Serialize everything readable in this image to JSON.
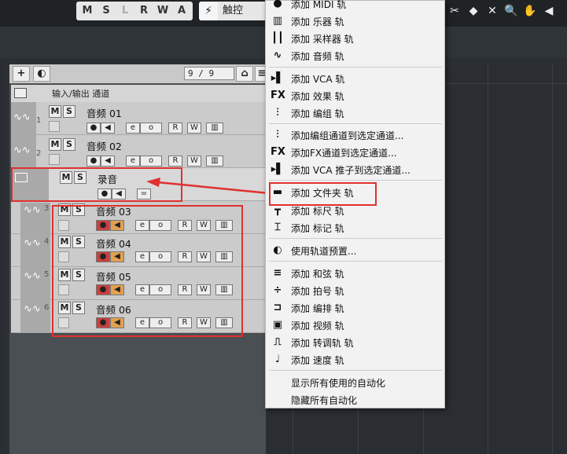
{
  "toolbar": {
    "modes": [
      "M",
      "S",
      "L",
      "R",
      "W",
      "A"
    ],
    "touch_label": "触控"
  },
  "track_header": {
    "counter": "9 / 9",
    "io_label": "输入/输出 通道"
  },
  "tracks": [
    {
      "num": "1",
      "name": "音频 01",
      "m": "M",
      "s": "S"
    },
    {
      "num": "2",
      "name": "音频 02",
      "m": "M",
      "s": "S"
    },
    {
      "num": "",
      "name": "录音",
      "m": "M",
      "s": "S"
    },
    {
      "num": "3",
      "name": "音频 03",
      "m": "M",
      "s": "S"
    },
    {
      "num": "4",
      "name": "音频 04",
      "m": "M",
      "s": "S"
    },
    {
      "num": "5",
      "name": "音频 05",
      "m": "M",
      "s": "S"
    },
    {
      "num": "6",
      "name": "音频 06",
      "m": "M",
      "s": "S"
    }
  ],
  "track_ctrl": {
    "e": "e",
    "o": "o",
    "r": "R",
    "w": "W"
  },
  "menu": {
    "items": [
      {
        "icon": "●",
        "label": "添加 MIDI 轨"
      },
      {
        "icon": "▥",
        "label": "添加 乐器 轨"
      },
      {
        "icon": "┃┃",
        "label": "添加 采样器 轨"
      },
      {
        "icon": "∿",
        "label": "添加 音频 轨"
      },
      {
        "icon": "▸▌",
        "label": "添加 VCA 轨"
      },
      {
        "icon": "FX",
        "label": "添加 效果 轨"
      },
      {
        "icon": "⫶",
        "label": "添加 编组 轨"
      },
      {
        "icon": "⫶",
        "label": "添加编组通道到选定通道..."
      },
      {
        "icon": "FX",
        "label": "添加FX通道到选定通道..."
      },
      {
        "icon": "▸▌",
        "label": "添加 VCA 推子到选定通道..."
      },
      {
        "icon": "▬",
        "label": "添加 文件夹 轨"
      },
      {
        "icon": "┳",
        "label": "添加 标尺 轨"
      },
      {
        "icon": "⌶",
        "label": "添加 标记 轨"
      },
      {
        "icon": "◐",
        "label": "使用轨道预置..."
      },
      {
        "icon": "≡",
        "label": "添加 和弦 轨"
      },
      {
        "icon": "÷",
        "label": "添加 拍号 轨"
      },
      {
        "icon": "⊐",
        "label": "添加 编排 轨"
      },
      {
        "icon": "▣",
        "label": "添加 视频 轨"
      },
      {
        "icon": "⎍",
        "label": "添加 转调轨 轨"
      },
      {
        "icon": "♩",
        "label": "添加 速度 轨"
      },
      {
        "icon": "",
        "label": "显示所有使用的自动化"
      },
      {
        "icon": "",
        "label": "隐藏所有自动化"
      }
    ]
  },
  "colors": {
    "highlight": "#e03030",
    "rec": "#c84040",
    "monitor": "#e2a050"
  }
}
